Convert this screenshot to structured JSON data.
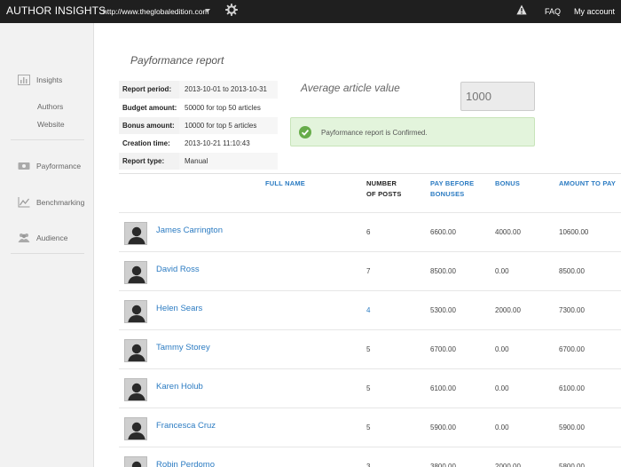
{
  "app": {
    "brand": "AUTHOR INSIGHTS",
    "site_url": "http://www.theglobaledition.com",
    "faq_label": "FAQ",
    "account_label": "My account",
    "colors": {
      "topbar": "#1f1f1f",
      "link": "#2b7bc2",
      "success_bg": "#e3f4dc",
      "success_icon": "#67ac4a"
    }
  },
  "sidebar": {
    "insights": {
      "label": "Insights",
      "icon": "bar-chart-icon"
    },
    "sub_items": [
      "Authors",
      "Website"
    ],
    "payformance": {
      "label": "Payformance",
      "icon": "money-icon"
    },
    "benchmarking": {
      "label": "Benchmarking",
      "icon": "line-chart-icon"
    },
    "audience": {
      "label": "Audience",
      "icon": "people-icon"
    }
  },
  "report": {
    "title": "Payformance report",
    "meta": [
      {
        "key": "Report period:",
        "value": "2013-10-01 to 2013-10-31"
      },
      {
        "key": "Budget amount:",
        "value": "50000 for top 50 articles"
      },
      {
        "key": "Bonus amount:",
        "value": "10000 for top 5 articles"
      },
      {
        "key": "Creation time:",
        "value": "2013-10-21 11:10:43"
      },
      {
        "key": "Report type:",
        "value": "Manual"
      }
    ],
    "avg_label": "Average article value",
    "avg_placeholder": "1000",
    "alert": "Payformance report is Confirmed."
  },
  "table": {
    "headers": {
      "full_name": "FULL NAME",
      "posts_1": "NUMBER",
      "posts_2": "OF POSTS",
      "pay_1": "PAY BEFORE",
      "pay_2": "BONUSES",
      "bonus": "BONUS",
      "amount": "AMOUNT TO PAY"
    },
    "rows": [
      {
        "name": "James Carrington",
        "posts": "6",
        "pay": "6600.00",
        "bonus": "4000.00",
        "amount": "10600.00"
      },
      {
        "name": "David Ross",
        "posts": "7",
        "pay": "8500.00",
        "bonus": "0.00",
        "amount": "8500.00"
      },
      {
        "name": "Helen Sears",
        "posts": "4",
        "pay": "5300.00",
        "bonus": "2000.00",
        "amount": "7300.00"
      },
      {
        "name": "Tammy Storey",
        "posts": "5",
        "pay": "6700.00",
        "bonus": "0.00",
        "amount": "6700.00"
      },
      {
        "name": "Karen Holub",
        "posts": "5",
        "pay": "6100.00",
        "bonus": "0.00",
        "amount": "6100.00"
      },
      {
        "name": "Francesca Cruz",
        "posts": "5",
        "pay": "5900.00",
        "bonus": "0.00",
        "amount": "5900.00"
      },
      {
        "name": "Robin Perdomo",
        "posts": "3",
        "pay": "3800.00",
        "bonus": "2000.00",
        "amount": "5800.00"
      }
    ]
  }
}
